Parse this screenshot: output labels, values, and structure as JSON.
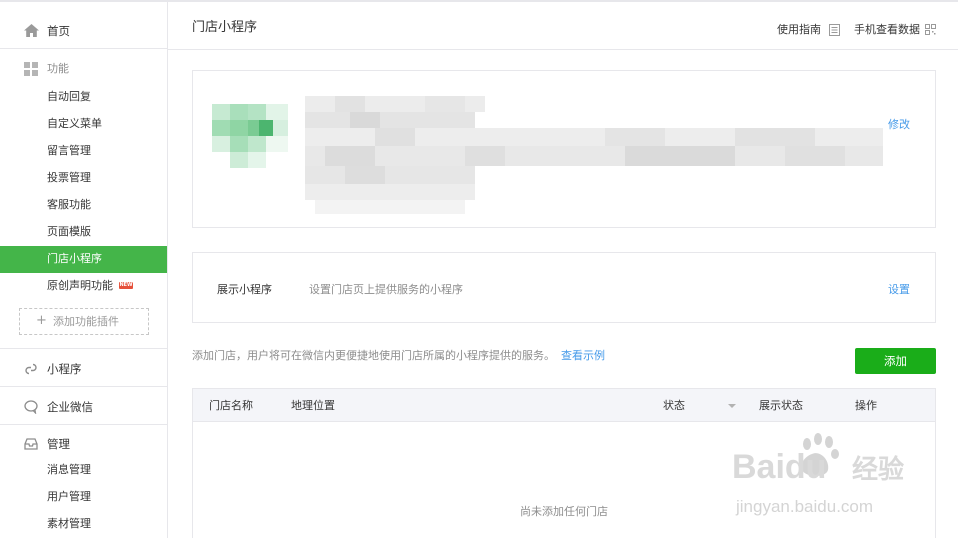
{
  "sidebar": {
    "home": {
      "label": "首页",
      "icon": "home-icon"
    },
    "function_group": {
      "label": "功能",
      "icon": "grid-icon",
      "items": [
        {
          "label": "自动回复"
        },
        {
          "label": "自定义菜单"
        },
        {
          "label": "留言管理"
        },
        {
          "label": "投票管理"
        },
        {
          "label": "客服功能"
        },
        {
          "label": "页面模版"
        },
        {
          "label": "门店小程序",
          "active": true
        },
        {
          "label": "原创声明功能",
          "badge": "NEW"
        }
      ],
      "add_plugin_label": "添加功能插件"
    },
    "miniprogram": {
      "label": "小程序",
      "icon": "link-icon"
    },
    "enterprise": {
      "label": "企业微信",
      "icon": "chat-bubble-icon"
    },
    "manage_group": {
      "label": "管理",
      "icon": "inbox-icon",
      "items": [
        {
          "label": "消息管理"
        },
        {
          "label": "用户管理"
        },
        {
          "label": "素材管理"
        }
      ]
    }
  },
  "header": {
    "title": "门店小程序",
    "guide_link": "使用指南",
    "mobile_link": "手机查看数据"
  },
  "profile": {
    "edit_label": "修改"
  },
  "mini_program_setting": {
    "label": "展示小程序",
    "description": "设置门店页上提供服务的小程序",
    "action": "设置"
  },
  "store_list": {
    "notice": "添加门店，用户将可在微信内更便捷地使用门店所属的小程序提供的服务。",
    "example_link": "查看示例",
    "add_button": "添加",
    "columns": [
      "门店名称",
      "地理位置",
      "状态",
      "展示状态",
      "操作"
    ],
    "empty_text": "尚未添加任何门店"
  },
  "watermark": {
    "brand": "Baidu",
    "brand_suffix": "经验",
    "url": "jingyan.baidu.com"
  },
  "colors": {
    "accent_green": "#44b549",
    "button_green": "#1aad19",
    "link_blue": "#459ae9",
    "border": "#e7e7eb"
  }
}
